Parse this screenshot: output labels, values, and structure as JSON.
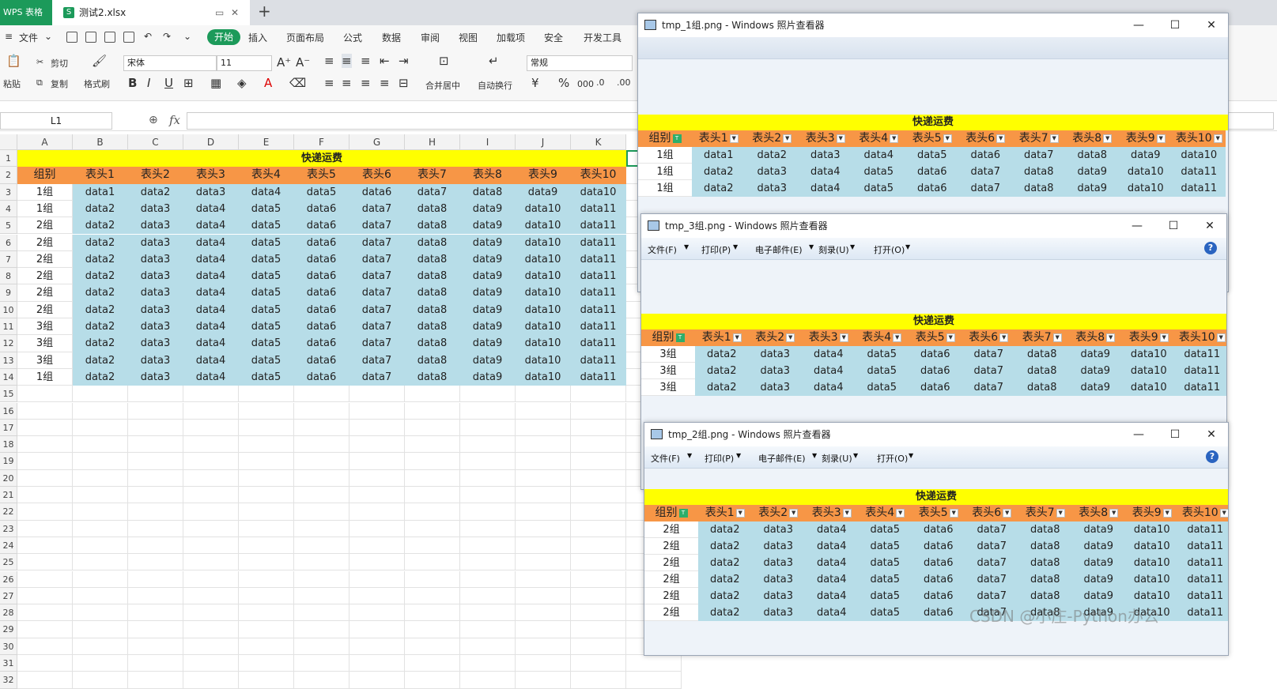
{
  "tabs": {
    "app": "WPS 表格",
    "file": "测试2.xlsx",
    "file_icon": "S"
  },
  "menu": {
    "file": "文件",
    "items": [
      "开始",
      "插入",
      "页面布局",
      "公式",
      "数据",
      "审阅",
      "视图",
      "加载项",
      "安全",
      "开发工具"
    ]
  },
  "ribbon": {
    "paste": "粘贴",
    "cut": "剪切",
    "copy": "复制",
    "format_painter": "格式刷",
    "font": "宋体",
    "size": "11",
    "merge": "合并居中",
    "wrap": "自动换行",
    "number_format": "常规",
    "currency": "¥",
    "percent": "%",
    "thousands": "000"
  },
  "formula": {
    "name_box": "L1",
    "fx": "fx"
  },
  "sheet": {
    "columns": [
      "A",
      "B",
      "C",
      "D",
      "E",
      "F",
      "G",
      "H",
      "I",
      "J",
      "K"
    ],
    "row_numbers": [
      "1",
      "2",
      "3",
      "4",
      "5",
      "6",
      "7",
      "8",
      "9",
      "10",
      "11",
      "12",
      "13",
      "14",
      "15",
      "16",
      "17",
      "18",
      "19",
      "20",
      "21",
      "22",
      "23",
      "24",
      "25",
      "26",
      "27",
      "28",
      "29",
      "30",
      "31",
      "32"
    ],
    "title": "快递运费",
    "headers": [
      "组别",
      "表头1",
      "表头2",
      "表头3",
      "表头4",
      "表头5",
      "表头6",
      "表头7",
      "表头8",
      "表头9",
      "表头10"
    ],
    "rows": [
      [
        "1组",
        "data1",
        "data2",
        "data3",
        "data4",
        "data5",
        "data6",
        "data7",
        "data8",
        "data9",
        "data10"
      ],
      [
        "1组",
        "data2",
        "data3",
        "data4",
        "data5",
        "data6",
        "data7",
        "data8",
        "data9",
        "data10",
        "data11"
      ],
      [
        "2组",
        "data2",
        "data3",
        "data4",
        "data5",
        "data6",
        "data7",
        "data8",
        "data9",
        "data10",
        "data11"
      ],
      [
        "2组",
        "data2",
        "data3",
        "data4",
        "data5",
        "data6",
        "data7",
        "data8",
        "data9",
        "data10",
        "data11"
      ],
      [
        "2组",
        "data2",
        "data3",
        "data4",
        "data5",
        "data6",
        "data7",
        "data8",
        "data9",
        "data10",
        "data11"
      ],
      [
        "2组",
        "data2",
        "data3",
        "data4",
        "data5",
        "data6",
        "data7",
        "data8",
        "data9",
        "data10",
        "data11"
      ],
      [
        "2组",
        "data2",
        "data3",
        "data4",
        "data5",
        "data6",
        "data7",
        "data8",
        "data9",
        "data10",
        "data11"
      ],
      [
        "2组",
        "data2",
        "data3",
        "data4",
        "data5",
        "data6",
        "data7",
        "data8",
        "data9",
        "data10",
        "data11"
      ],
      [
        "3组",
        "data2",
        "data3",
        "data4",
        "data5",
        "data6",
        "data7",
        "data8",
        "data9",
        "data10",
        "data11"
      ],
      [
        "3组",
        "data2",
        "data3",
        "data4",
        "data5",
        "data6",
        "data7",
        "data8",
        "data9",
        "data10",
        "data11"
      ],
      [
        "3组",
        "data2",
        "data3",
        "data4",
        "data5",
        "data6",
        "data7",
        "data8",
        "data9",
        "data10",
        "data11"
      ],
      [
        "1组",
        "data2",
        "data3",
        "data4",
        "data5",
        "data6",
        "data7",
        "data8",
        "data9",
        "data10",
        "data11"
      ]
    ]
  },
  "viewers": [
    {
      "title": "tmp_1组.png - Windows 照片查看器",
      "show_menu": false,
      "menu": [],
      "table_title": "快递运费",
      "headers": [
        "组别",
        "表头1",
        "表头2",
        "表头3",
        "表头4",
        "表头5",
        "表头6",
        "表头7",
        "表头8",
        "表头9",
        "表头10"
      ],
      "rows": [
        [
          "1组",
          "data1",
          "data2",
          "data3",
          "data4",
          "data5",
          "data6",
          "data7",
          "data8",
          "data9",
          "data10"
        ],
        [
          "1组",
          "data2",
          "data3",
          "data4",
          "data5",
          "data6",
          "data7",
          "data8",
          "data9",
          "data10",
          "data11"
        ],
        [
          "1组",
          "data2",
          "data3",
          "data4",
          "data5",
          "data6",
          "data7",
          "data8",
          "data9",
          "data10",
          "data11"
        ]
      ]
    },
    {
      "title": "tmp_3组.png - Windows 照片查看器",
      "show_menu": true,
      "menu": [
        "文件(F)",
        "打印(P)",
        "电子邮件(E)",
        "刻录(U)",
        "打开(O)"
      ],
      "table_title": "快递运费",
      "headers": [
        "组别",
        "表头1",
        "表头2",
        "表头3",
        "表头4",
        "表头5",
        "表头6",
        "表头7",
        "表头8",
        "表头9",
        "表头10"
      ],
      "rows": [
        [
          "3组",
          "data2",
          "data3",
          "data4",
          "data5",
          "data6",
          "data7",
          "data8",
          "data9",
          "data10",
          "data11"
        ],
        [
          "3组",
          "data2",
          "data3",
          "data4",
          "data5",
          "data6",
          "data7",
          "data8",
          "data9",
          "data10",
          "data11"
        ],
        [
          "3组",
          "data2",
          "data3",
          "data4",
          "data5",
          "data6",
          "data7",
          "data8",
          "data9",
          "data10",
          "data11"
        ]
      ]
    },
    {
      "title": "tmp_2组.png - Windows 照片查看器",
      "show_menu": true,
      "menu": [
        "文件(F)",
        "打印(P)",
        "电子邮件(E)",
        "刻录(U)",
        "打开(O)"
      ],
      "table_title": "快递运费",
      "headers": [
        "组别",
        "表头1",
        "表头2",
        "表头3",
        "表头4",
        "表头5",
        "表头6",
        "表头7",
        "表头8",
        "表头9",
        "表头10"
      ],
      "rows": [
        [
          "2组",
          "data2",
          "data3",
          "data4",
          "data5",
          "data6",
          "data7",
          "data8",
          "data9",
          "data10",
          "data11"
        ],
        [
          "2组",
          "data2",
          "data3",
          "data4",
          "data5",
          "data6",
          "data7",
          "data8",
          "data9",
          "data10",
          "data11"
        ],
        [
          "2组",
          "data2",
          "data3",
          "data4",
          "data5",
          "data6",
          "data7",
          "data8",
          "data9",
          "data10",
          "data11"
        ],
        [
          "2组",
          "data2",
          "data3",
          "data4",
          "data5",
          "data6",
          "data7",
          "data8",
          "data9",
          "data10",
          "data11"
        ],
        [
          "2组",
          "data2",
          "data3",
          "data4",
          "data5",
          "data6",
          "data7",
          "data8",
          "data9",
          "data10",
          "data11"
        ],
        [
          "2组",
          "data2",
          "data3",
          "data4",
          "data5",
          "data6",
          "data7",
          "data8",
          "data9",
          "data10",
          "data11"
        ]
      ]
    }
  ],
  "window_controls": {
    "minimize": "—",
    "maximize": "☐",
    "close": "✕",
    "help": "?"
  },
  "watermark": "CSDN @小庄-Python办公",
  "colors": {
    "title_fill": "#ffff00",
    "header_fill": "#f79646",
    "data_fill": "#b7dde8",
    "accent": "#1c9a5a"
  }
}
